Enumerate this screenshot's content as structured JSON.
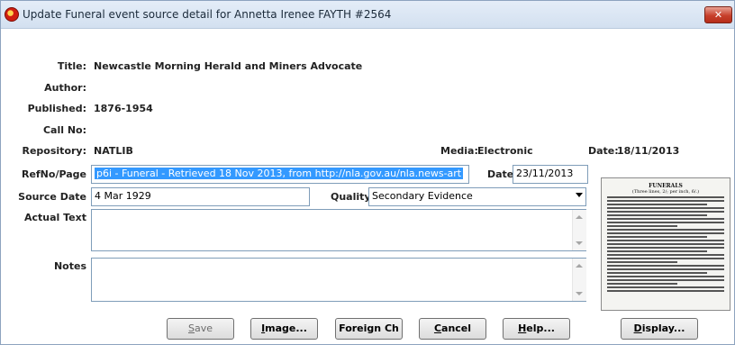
{
  "window": {
    "title": "Update Funeral event source detail for Annetta Irenee FAYTH  #2564",
    "close_label": "✕"
  },
  "source": {
    "title_label": "Title:",
    "title_value": "Newcastle Morning Herald and Miners Advocate",
    "author_label": "Author:",
    "author_value": "",
    "published_label": "Published:",
    "published_value": "1876-1954",
    "callno_label": "Call No:",
    "callno_value": "",
    "repository_label": "Repository:",
    "repository_value": "NATLIB",
    "media_label": "Media:",
    "media_value": "Electronic",
    "date_label": "Date:",
    "date_value": "18/11/2013"
  },
  "form": {
    "refno_label": "RefNo/Page",
    "refno_value": "p6i - Funeral - Retrieved 18 Nov 2013, from http://nla.gov.au/nla.news-art",
    "date_label": "Date",
    "date_value": "23/11/2013",
    "source_date_label": "Source Date",
    "source_date_value": "4 Mar 1929",
    "quality_label": "Quality",
    "quality_value": "Secondary Evidence",
    "actual_text_label": "Actual Text",
    "actual_text_value": "",
    "notes_label": "Notes",
    "notes_value": ""
  },
  "thumbnail": {
    "heading": "FUNERALS",
    "subheading": "(Three lines, 2/; per inch, 6/.)"
  },
  "buttons": [
    {
      "prefix": "",
      "key": "S",
      "suffix": "ave",
      "enabled": false
    },
    {
      "prefix": "",
      "key": "I",
      "suffix": "mage...",
      "enabled": true
    },
    {
      "prefix": "Foreign Ch",
      "key": "",
      "suffix": "",
      "enabled": true
    },
    {
      "prefix": "",
      "key": "C",
      "suffix": "ancel",
      "enabled": true
    },
    {
      "prefix": "",
      "key": "H",
      "suffix": "elp...",
      "enabled": true
    },
    {
      "prefix": "",
      "key": "D",
      "suffix": "isplay...",
      "enabled": true
    }
  ]
}
